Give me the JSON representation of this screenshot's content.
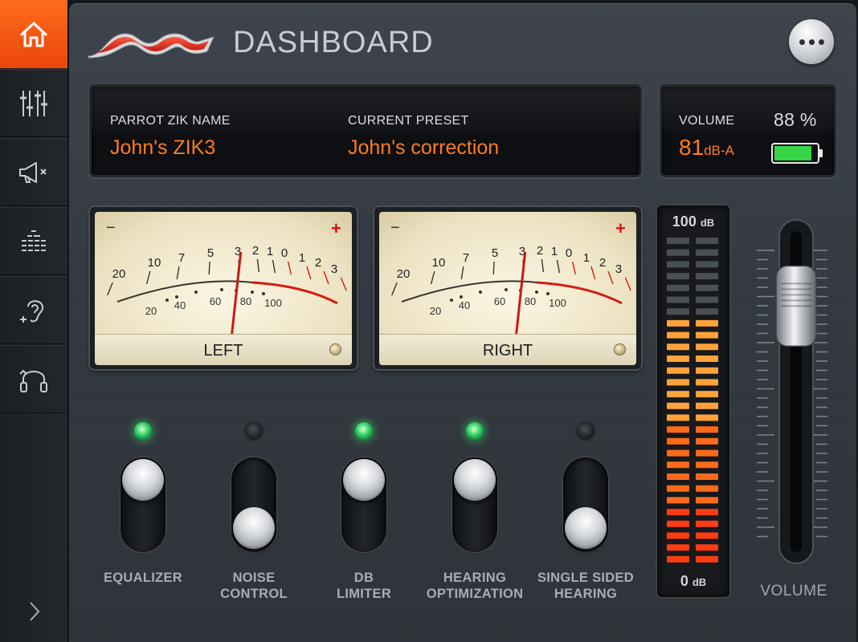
{
  "sidebar": {
    "items": [
      {
        "icon": "home-icon",
        "active": true
      },
      {
        "icon": "sliders-icon",
        "active": false
      },
      {
        "icon": "megaphone-mute-icon",
        "active": false
      },
      {
        "icon": "equalizer-bars-icon",
        "active": false
      },
      {
        "icon": "ear-plus-icon",
        "active": false
      },
      {
        "icon": "headphones-reset-icon",
        "active": false
      }
    ],
    "expand_icon": "chevron-right-icon"
  },
  "header": {
    "title": "DASHBOARD",
    "more_icon": "more-dots-icon"
  },
  "info": {
    "name_label": "PARROT ZIK NAME",
    "name_value": "John's ZIK3",
    "preset_label": "CURRENT PRESET",
    "preset_value": "John's correction"
  },
  "status": {
    "volume_label": "VOLUME",
    "volume_value": "81",
    "volume_unit": "dB-A",
    "battery_percent": "88 %",
    "battery_level": 0.88,
    "battery_color": "#36d548"
  },
  "meters": {
    "minus": "−",
    "plus": "+",
    "top_scale": [
      "20",
      "10",
      "7",
      "5",
      "3",
      "2",
      "1",
      "0",
      "1",
      "2",
      "3"
    ],
    "bottom_scale": [
      "20",
      "40",
      "60",
      "80",
      "100"
    ],
    "left_label": "LEFT",
    "right_label": "RIGHT",
    "left_needle_fraction": 0.55,
    "right_needle_fraction": 0.55
  },
  "level_meter": {
    "top_value": "100",
    "bottom_value": "0",
    "unit": "dB",
    "segments_total": 28,
    "segments_lit": 21,
    "colors": {
      "red": "#ff3c12",
      "orange": "#ff6a1a",
      "amber": "#ffa23a",
      "off": "#4a4f55"
    }
  },
  "volume": {
    "caption": "VOLUME",
    "level": 0.78
  },
  "toggles": [
    {
      "label_line1": "EQUALIZER",
      "label_line2": "",
      "on": true
    },
    {
      "label_line1": "NOISE",
      "label_line2": "CONTROL",
      "on": false
    },
    {
      "label_line1": "DB",
      "label_line2": "LIMITER",
      "on": true
    },
    {
      "label_line1": "HEARING",
      "label_line2": "OPTIMIZATION",
      "on": true
    },
    {
      "label_line1": "SINGLE SIDED",
      "label_line2": "HEARING",
      "on": false
    }
  ],
  "accent_color": "#ff7a22"
}
